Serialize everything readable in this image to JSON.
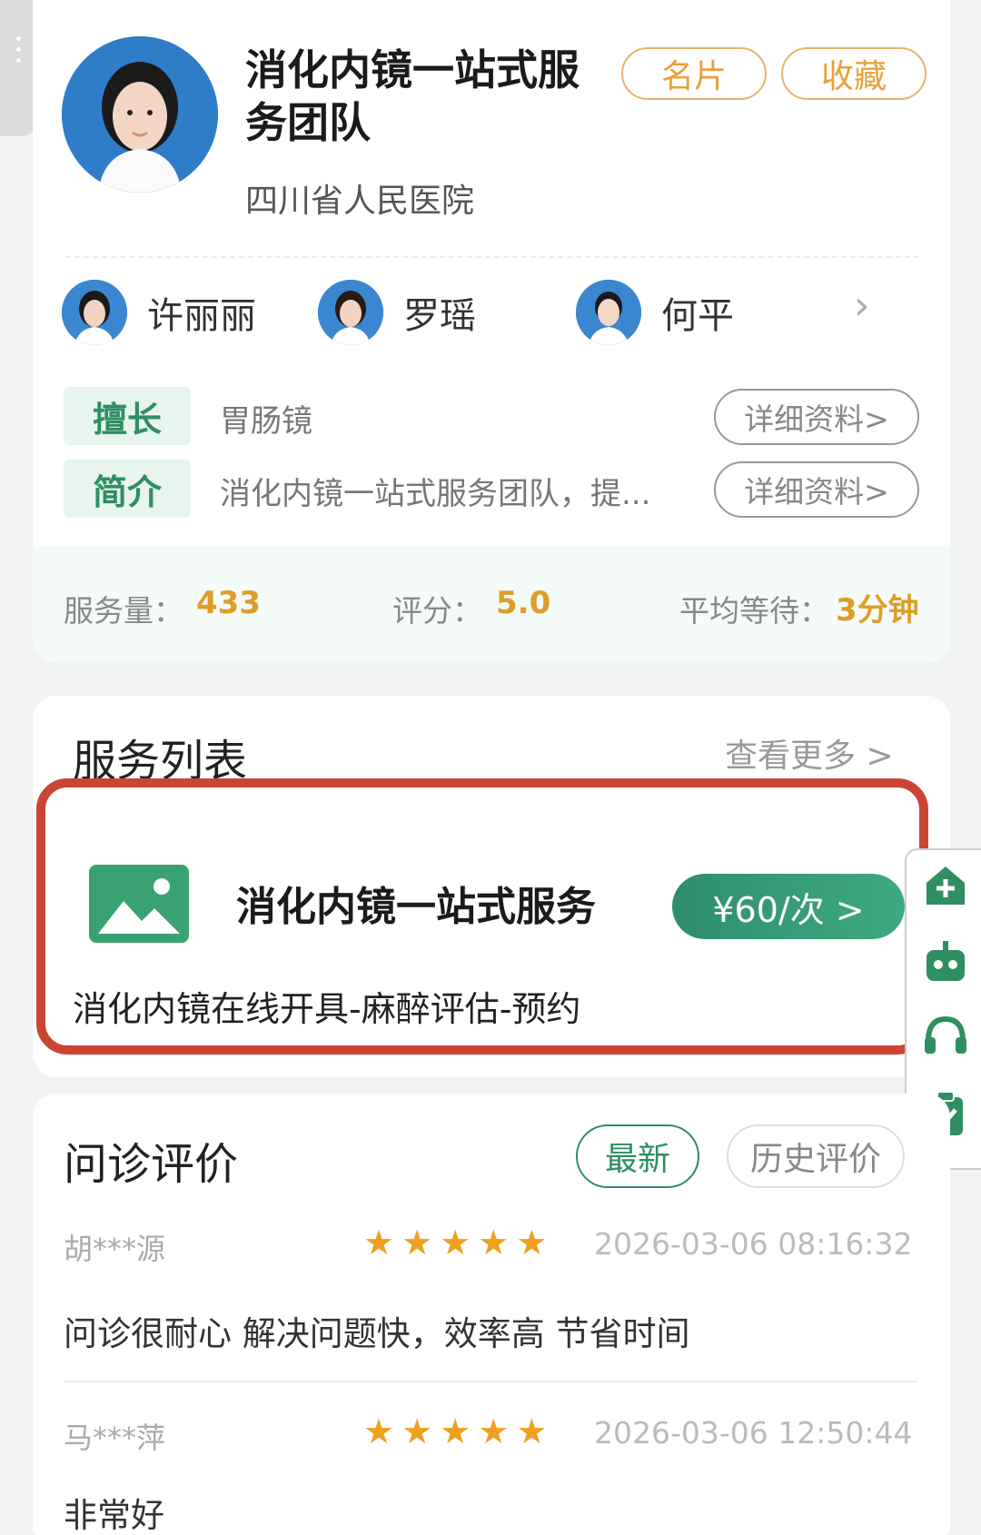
{
  "header": {
    "team_title": "消化内镜一站式服务团队",
    "hospital": "四川省人民医院",
    "card_button": "名片",
    "favorite_button": "收藏"
  },
  "members": [
    {
      "name": "许丽丽"
    },
    {
      "name": "罗瑶"
    },
    {
      "name": "何平"
    }
  ],
  "tags": {
    "specialty_label": "擅长",
    "specialty_text": "胃肠镜",
    "intro_label": "简介",
    "intro_text": "消化内镜一站式服务团队，提...",
    "detail_button": "详细资料>"
  },
  "stats": {
    "service_label": "服务量：",
    "service_value": "433",
    "rating_label": "评分：",
    "rating_value": "5.0",
    "wait_label": "平均等待：",
    "wait_value": "3分钟"
  },
  "service_list": {
    "title": "服务列表",
    "more": "查看更多 >",
    "item": {
      "name": "消化内镜一站式服务",
      "price": "¥60/次 >",
      "desc": "消化内镜在线开具-麻醉评估-预约"
    }
  },
  "reviews": {
    "title": "问诊评价",
    "filter_latest": "最新",
    "filter_history": "历史评价",
    "items": [
      {
        "user": "胡***源",
        "stars": 5,
        "time": "2026-03-06 08:16:32",
        "text": "问诊很耐心 解决问题快，效率高 节省时间"
      },
      {
        "user": "马***萍",
        "stars": 5,
        "time": "2026-03-06 12:50:44",
        "text": "非常好"
      }
    ]
  },
  "side_toolbar": [
    "home-plus-icon",
    "robot-icon",
    "headset-icon",
    "clipboard-check-icon"
  ],
  "colors": {
    "accent_green": "#2f8e62",
    "accent_orange": "#e09c28",
    "frame_red": "#c94534"
  }
}
